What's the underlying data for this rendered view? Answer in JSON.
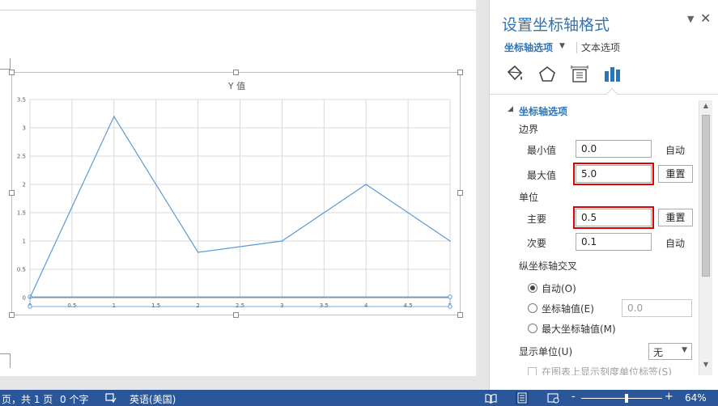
{
  "document": {
    "chart": {
      "title": "Y 值"
    }
  },
  "chart_data": {
    "type": "scatter",
    "title": "Y 值",
    "x": [
      0,
      1,
      2,
      3,
      4,
      5
    ],
    "y": [
      0,
      3.2,
      0.8,
      1.0,
      2.0,
      1.0
    ],
    "xlim": [
      0,
      5
    ],
    "ylim": [
      0,
      3.5
    ],
    "x_ticks": [
      "0",
      "0.5",
      "1",
      "1.5",
      "2",
      "2.5",
      "3",
      "3.5",
      "4",
      "4.5",
      "5"
    ],
    "y_ticks": [
      "0",
      "0.5",
      "1",
      "1.5",
      "2",
      "2.5",
      "3",
      "3.5"
    ],
    "grid": true,
    "series_color": "#5b9bd5",
    "line_style": "straight lines"
  },
  "panel": {
    "title": "设置坐标轴格式",
    "tabs": [
      {
        "label": "坐标轴选项",
        "active": true
      },
      {
        "label": "文本选项",
        "active": false
      }
    ],
    "icons": [
      "fill-line-icon",
      "effects-icon",
      "size-properties-icon",
      "axis-options-icon"
    ],
    "section": {
      "title": "坐标轴选项",
      "bounds_label": "边界",
      "min_label": "最小值",
      "min_value": "0.0",
      "min_state": "自动",
      "max_label": "最大值",
      "max_value": "5.0",
      "max_reset": "重置",
      "units_label": "单位",
      "major_label": "主要",
      "major_value": "0.5",
      "major_reset": "重置",
      "minor_label": "次要",
      "minor_value": "0.1",
      "minor_state": "自动",
      "cross_label": "纵坐标轴交叉",
      "cross_options": [
        {
          "label": "自动(O)",
          "checked": true
        },
        {
          "label": "坐标轴值(E)",
          "checked": false
        },
        {
          "label": "最大坐标轴值(M)",
          "checked": false
        }
      ],
      "cross_value": "0.0",
      "display_units_label": "显示单位(U)",
      "display_units_value": "无",
      "show_units_label": "在图表上显示刻度单位标签(S)"
    }
  },
  "statusbar": {
    "page": "页，共 1 页",
    "words": "0 个字",
    "language": "英语(美国)",
    "zoom": "64%",
    "zoom_minus": "-",
    "zoom_plus": "+"
  },
  "colors": {
    "accent": "#2e75b6",
    "statusbar": "#2b579a",
    "highlight": "#e00000",
    "series": "#5b9bd5"
  }
}
